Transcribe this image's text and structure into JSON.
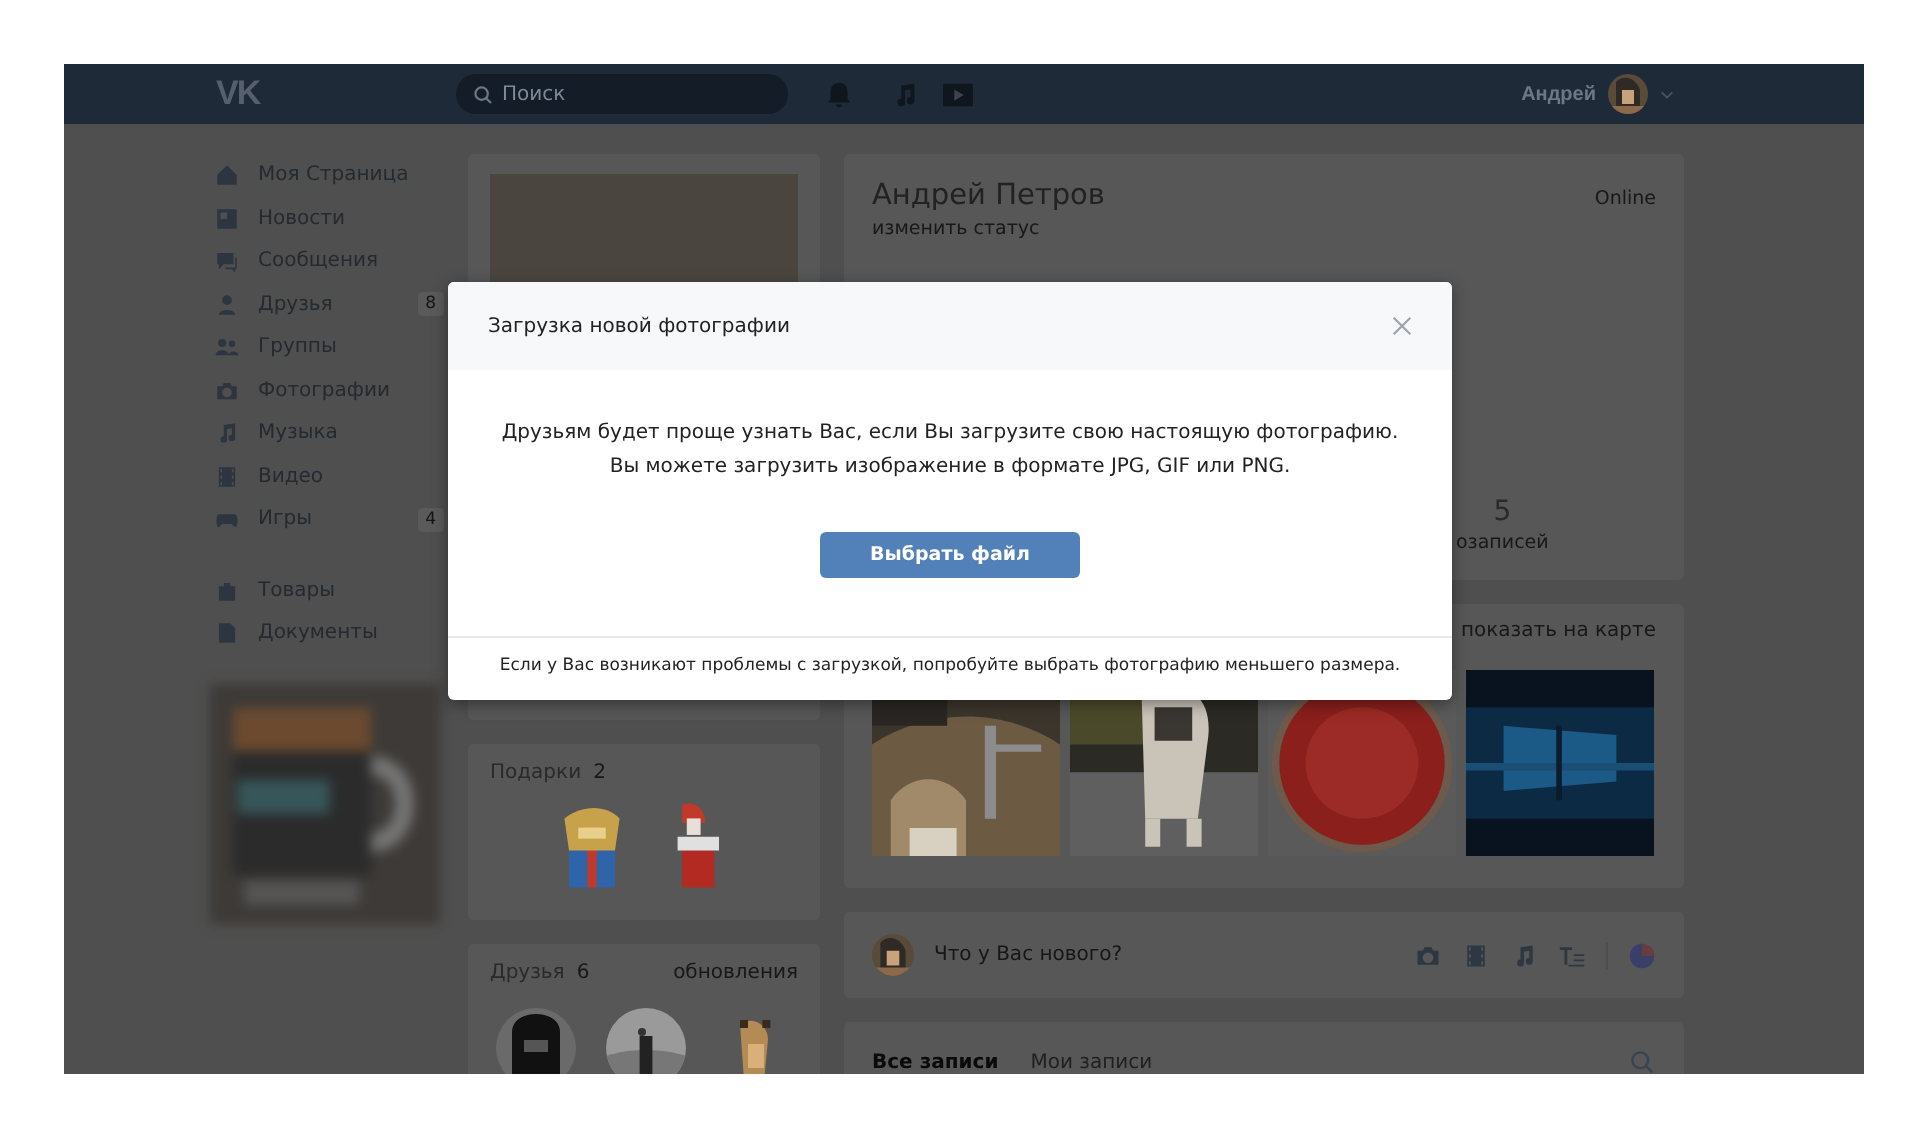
{
  "header": {
    "logo": "VK",
    "search": {
      "placeholder": "Поиск"
    },
    "user_name": "Андрей"
  },
  "sidebar": {
    "main": [
      {
        "label": "Моя Страница"
      },
      {
        "label": "Новости"
      },
      {
        "label": "Сообщения"
      },
      {
        "label": "Друзья",
        "count": "8"
      },
      {
        "label": "Группы"
      },
      {
        "label": "Фотографии"
      },
      {
        "label": "Музыка"
      },
      {
        "label": "Видео"
      },
      {
        "label": "Игры",
        "count": "4"
      }
    ],
    "extra": [
      {
        "label": "Товары"
      },
      {
        "label": "Документы"
      }
    ]
  },
  "gifts": {
    "title": "Подарки",
    "count": "2"
  },
  "friends": {
    "title": "Друзья",
    "count": "6",
    "link": "обновления"
  },
  "profile": {
    "name": "Андрей Петров",
    "status_link": "изменить статус",
    "online": "Online",
    "counter": {
      "value": "5",
      "label": "озаписей"
    }
  },
  "photos": {
    "map_link": "показать на карте"
  },
  "post_box": {
    "placeholder": "Что у Вас нового?"
  },
  "wall": {
    "tabs": [
      {
        "label": "Все записи",
        "selected": true
      },
      {
        "label": "Мои записи",
        "selected": false
      }
    ]
  },
  "dialog": {
    "title": "Загрузка новой фотографии",
    "lines": [
      "Друзьям будет проще узнать Вас, если Вы загрузите свою настоящую фотографию.",
      "Вы можете загрузить изображение в формате JPG, GIF или PNG."
    ],
    "button": "Выбрать файл",
    "footer": "Если у Вас возникают проблемы с загрузкой, попробуйте выбрать фотографию меньшего размера."
  }
}
